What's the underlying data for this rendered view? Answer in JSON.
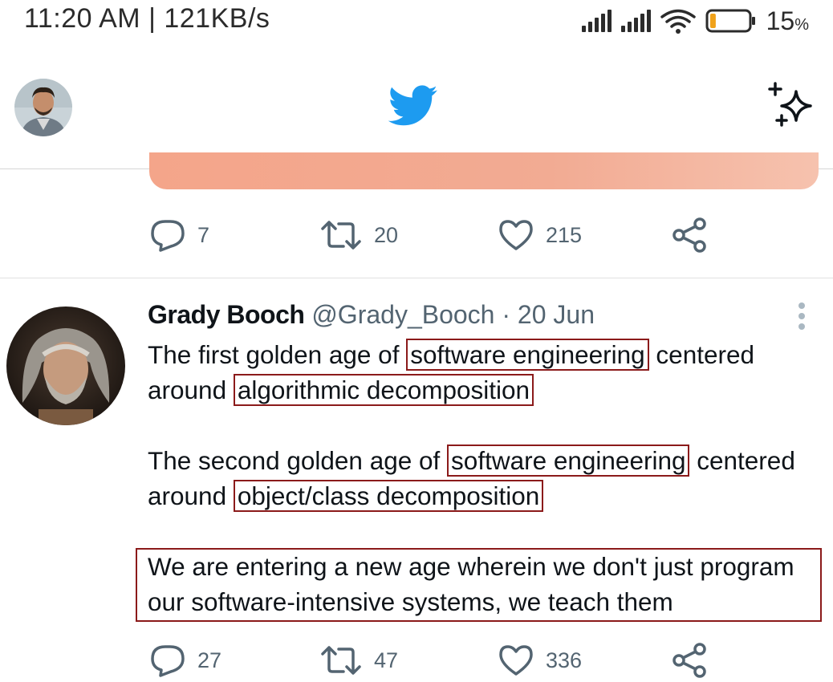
{
  "status_bar": {
    "time_speed": "11:20 AM | 121KB/s",
    "battery_percent": "15",
    "battery_unit": "%",
    "battery_level": 0.15,
    "icons": [
      "signal-icon",
      "signal-icon",
      "wifi-icon",
      "battery-icon"
    ]
  },
  "header": {
    "logo_icon": "twitter-bird-icon",
    "sparkle_icon": "sparkle-icon",
    "brand_color": "#1d9bf0"
  },
  "prev_tweet": {
    "replies": "7",
    "retweets": "20",
    "likes": "215"
  },
  "tweet": {
    "author": "Grady Booch",
    "handle": "@Grady_Booch",
    "separator": "·",
    "date": "20 Jun",
    "p1_pre": "The first golden age of",
    "p1_hl1": "software engineering",
    "p1_mid": "centered around",
    "p1_hl2": "algorithmic decomposition",
    "p2_pre": "The second golden age of",
    "p2_hl1": "software engineering",
    "p2_mid": "centered around",
    "p2_hl2": "object/class decomposition",
    "p3_line1": "We are entering a new age wherein we don't just program",
    "p3_line2": "our software-intensive systems, we teach them",
    "replies": "27",
    "retweets": "47",
    "likes": "336"
  },
  "colors": {
    "annotation_box": "#8b1a1a",
    "muted_text": "#536471"
  }
}
